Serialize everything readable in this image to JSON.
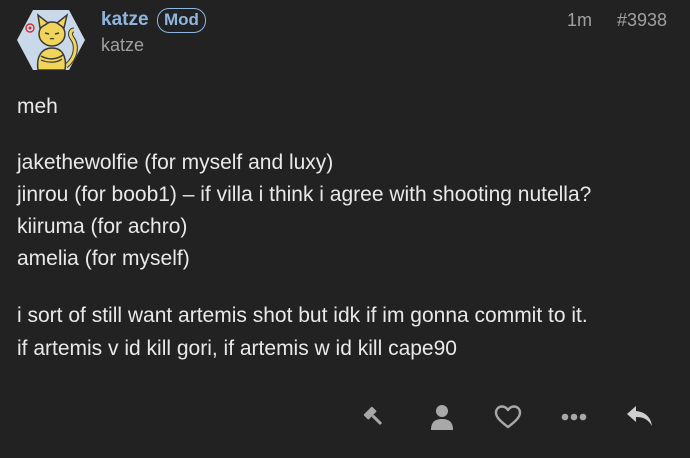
{
  "post": {
    "username": "katze",
    "badge": "Mod",
    "user_title": "katze",
    "time": "1m",
    "number": "#3938",
    "lines": [
      "meh",
      "jakethewolfie (for myself and luxy)",
      "jinrou (for boob1) – if villa i think i agree with shooting nutella?",
      "kiiruma (for achro)",
      "amelia (for myself)",
      "i sort of still want artemis shot but idk if im gonna commit to it.",
      "if artemis v id kill gori, if artemis w id kill cape90"
    ]
  },
  "actions": [
    {
      "name": "flag-icon"
    },
    {
      "name": "user-icon"
    },
    {
      "name": "heart-icon"
    },
    {
      "name": "more-icon"
    },
    {
      "name": "reply-icon"
    }
  ],
  "colors": {
    "background": "#222222",
    "text": "#e9e9e9",
    "muted": "#a0a0a0",
    "accent": "#8fb6df",
    "icon": "#a8a8a8"
  }
}
